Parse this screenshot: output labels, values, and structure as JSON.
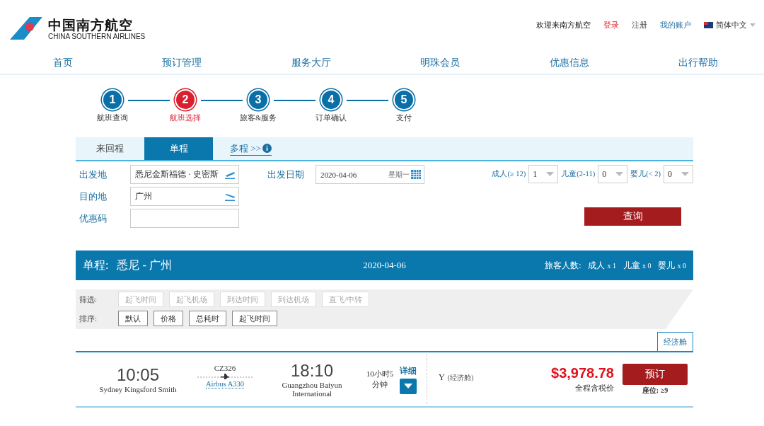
{
  "header": {
    "logo": {
      "name_cn": "中国南方航空",
      "name_en": "CHINA SOUTHERN AIRLINES"
    },
    "top_links": [
      {
        "text": "欢迎来南方航空",
        "kind": "welcome"
      },
      {
        "text": "登录",
        "kind": "login"
      },
      {
        "text": "注册",
        "kind": "register"
      },
      {
        "text": "我的账户",
        "kind": "account"
      }
    ],
    "language": "简体中文"
  },
  "nav": [
    "首页",
    "预订管理",
    "服务大厅",
    "明珠会员",
    "优惠信息",
    "出行帮助"
  ],
  "steps": [
    {
      "number": "1",
      "label": "航班查询",
      "selected": false
    },
    {
      "number": "2",
      "label": "航班选择",
      "selected": true
    },
    {
      "number": "3",
      "label": "旅客&服务",
      "selected": false
    },
    {
      "number": "4",
      "label": "订单确认",
      "selected": false
    },
    {
      "number": "5",
      "label": "支付",
      "selected": false
    }
  ],
  "trip_tabs": [
    {
      "label": "来回程",
      "selected": false,
      "kind": "tab"
    },
    {
      "label": "单程",
      "selected": true,
      "kind": "tab"
    },
    {
      "label": "多程 >>",
      "selected": false,
      "kind": "link"
    }
  ],
  "form": {
    "origin": {
      "label": "出发地",
      "value": "悉尼金斯福德 · 史密斯"
    },
    "destination": {
      "label": "目的地",
      "value": "广州"
    },
    "promo": {
      "label": "优惠码"
    },
    "date": {
      "label": "出发日期",
      "value": "2020-04-06",
      "weekday": "星期一"
    },
    "passengers": [
      {
        "label": "成人(≥ 12)",
        "value": "1"
      },
      {
        "label": "儿童(2-11)",
        "value": "0"
      },
      {
        "label": "婴儿(< 2)",
        "value": "0"
      }
    ],
    "search_button": "查询"
  },
  "summary": {
    "trip_type": "单程:",
    "route": "悉尼  -  广州",
    "date": "2020-04-06",
    "passenger_label": "旅客人数:",
    "counts": [
      {
        "label": "成人",
        "count": "x 1"
      },
      {
        "label": "儿童",
        "count": "x 0"
      },
      {
        "label": "婴儿",
        "count": "x 0"
      }
    ]
  },
  "filter": {
    "label": "筛选:",
    "options": [
      {
        "text": "起飞时间",
        "disabled": true
      },
      {
        "text": "起飞机场",
        "disabled": true
      },
      {
        "text": "到达时间",
        "disabled": true
      },
      {
        "text": "到达机场",
        "disabled": true
      },
      {
        "text": "直飞/中转",
        "disabled": true
      }
    ]
  },
  "sort": {
    "label": "排序:",
    "options": [
      {
        "text": "默认",
        "disabled": false
      },
      {
        "text": "价格",
        "disabled": false
      },
      {
        "text": "总耗时",
        "disabled": false
      },
      {
        "text": "起飞时间",
        "disabled": false
      }
    ]
  },
  "cabin_tabs": [
    {
      "label": "经济舱",
      "selected": true
    }
  ],
  "flight": {
    "departure_time": "10:05",
    "departure_airport": "Sydney Kingsford Smith",
    "flight_number": "CZ326",
    "aircraft": "Airbus A330",
    "arrival_time": "18:10",
    "arrival_airport": "Guangzhou Baiyun International",
    "duration": "10小时5分钟",
    "details": "详细",
    "cabin_code": "Y",
    "cabin_name": "(经济舱)",
    "price": "$3,978.78",
    "price_note": "全程含税价",
    "book_button": "预订",
    "seats": "座位: ≥9"
  }
}
